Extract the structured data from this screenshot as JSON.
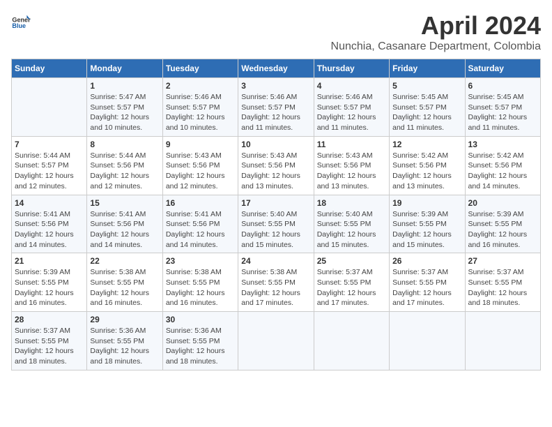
{
  "header": {
    "logo_general": "General",
    "logo_blue": "Blue",
    "main_title": "April 2024",
    "subtitle": "Nunchia, Casanare Department, Colombia"
  },
  "calendar": {
    "days_of_week": [
      "Sunday",
      "Monday",
      "Tuesday",
      "Wednesday",
      "Thursday",
      "Friday",
      "Saturday"
    ],
    "weeks": [
      [
        {
          "day": "",
          "info": ""
        },
        {
          "day": "1",
          "info": "Sunrise: 5:47 AM\nSunset: 5:57 PM\nDaylight: 12 hours\nand 10 minutes."
        },
        {
          "day": "2",
          "info": "Sunrise: 5:46 AM\nSunset: 5:57 PM\nDaylight: 12 hours\nand 10 minutes."
        },
        {
          "day": "3",
          "info": "Sunrise: 5:46 AM\nSunset: 5:57 PM\nDaylight: 12 hours\nand 11 minutes."
        },
        {
          "day": "4",
          "info": "Sunrise: 5:46 AM\nSunset: 5:57 PM\nDaylight: 12 hours\nand 11 minutes."
        },
        {
          "day": "5",
          "info": "Sunrise: 5:45 AM\nSunset: 5:57 PM\nDaylight: 12 hours\nand 11 minutes."
        },
        {
          "day": "6",
          "info": "Sunrise: 5:45 AM\nSunset: 5:57 PM\nDaylight: 12 hours\nand 11 minutes."
        }
      ],
      [
        {
          "day": "7",
          "info": "Sunrise: 5:44 AM\nSunset: 5:57 PM\nDaylight: 12 hours\nand 12 minutes."
        },
        {
          "day": "8",
          "info": "Sunrise: 5:44 AM\nSunset: 5:56 PM\nDaylight: 12 hours\nand 12 minutes."
        },
        {
          "day": "9",
          "info": "Sunrise: 5:43 AM\nSunset: 5:56 PM\nDaylight: 12 hours\nand 12 minutes."
        },
        {
          "day": "10",
          "info": "Sunrise: 5:43 AM\nSunset: 5:56 PM\nDaylight: 12 hours\nand 13 minutes."
        },
        {
          "day": "11",
          "info": "Sunrise: 5:43 AM\nSunset: 5:56 PM\nDaylight: 12 hours\nand 13 minutes."
        },
        {
          "day": "12",
          "info": "Sunrise: 5:42 AM\nSunset: 5:56 PM\nDaylight: 12 hours\nand 13 minutes."
        },
        {
          "day": "13",
          "info": "Sunrise: 5:42 AM\nSunset: 5:56 PM\nDaylight: 12 hours\nand 14 minutes."
        }
      ],
      [
        {
          "day": "14",
          "info": "Sunrise: 5:41 AM\nSunset: 5:56 PM\nDaylight: 12 hours\nand 14 minutes."
        },
        {
          "day": "15",
          "info": "Sunrise: 5:41 AM\nSunset: 5:56 PM\nDaylight: 12 hours\nand 14 minutes."
        },
        {
          "day": "16",
          "info": "Sunrise: 5:41 AM\nSunset: 5:56 PM\nDaylight: 12 hours\nand 14 minutes."
        },
        {
          "day": "17",
          "info": "Sunrise: 5:40 AM\nSunset: 5:55 PM\nDaylight: 12 hours\nand 15 minutes."
        },
        {
          "day": "18",
          "info": "Sunrise: 5:40 AM\nSunset: 5:55 PM\nDaylight: 12 hours\nand 15 minutes."
        },
        {
          "day": "19",
          "info": "Sunrise: 5:39 AM\nSunset: 5:55 PM\nDaylight: 12 hours\nand 15 minutes."
        },
        {
          "day": "20",
          "info": "Sunrise: 5:39 AM\nSunset: 5:55 PM\nDaylight: 12 hours\nand 16 minutes."
        }
      ],
      [
        {
          "day": "21",
          "info": "Sunrise: 5:39 AM\nSunset: 5:55 PM\nDaylight: 12 hours\nand 16 minutes."
        },
        {
          "day": "22",
          "info": "Sunrise: 5:38 AM\nSunset: 5:55 PM\nDaylight: 12 hours\nand 16 minutes."
        },
        {
          "day": "23",
          "info": "Sunrise: 5:38 AM\nSunset: 5:55 PM\nDaylight: 12 hours\nand 16 minutes."
        },
        {
          "day": "24",
          "info": "Sunrise: 5:38 AM\nSunset: 5:55 PM\nDaylight: 12 hours\nand 17 minutes."
        },
        {
          "day": "25",
          "info": "Sunrise: 5:37 AM\nSunset: 5:55 PM\nDaylight: 12 hours\nand 17 minutes."
        },
        {
          "day": "26",
          "info": "Sunrise: 5:37 AM\nSunset: 5:55 PM\nDaylight: 12 hours\nand 17 minutes."
        },
        {
          "day": "27",
          "info": "Sunrise: 5:37 AM\nSunset: 5:55 PM\nDaylight: 12 hours\nand 18 minutes."
        }
      ],
      [
        {
          "day": "28",
          "info": "Sunrise: 5:37 AM\nSunset: 5:55 PM\nDaylight: 12 hours\nand 18 minutes."
        },
        {
          "day": "29",
          "info": "Sunrise: 5:36 AM\nSunset: 5:55 PM\nDaylight: 12 hours\nand 18 minutes."
        },
        {
          "day": "30",
          "info": "Sunrise: 5:36 AM\nSunset: 5:55 PM\nDaylight: 12 hours\nand 18 minutes."
        },
        {
          "day": "",
          "info": ""
        },
        {
          "day": "",
          "info": ""
        },
        {
          "day": "",
          "info": ""
        },
        {
          "day": "",
          "info": ""
        }
      ]
    ]
  }
}
